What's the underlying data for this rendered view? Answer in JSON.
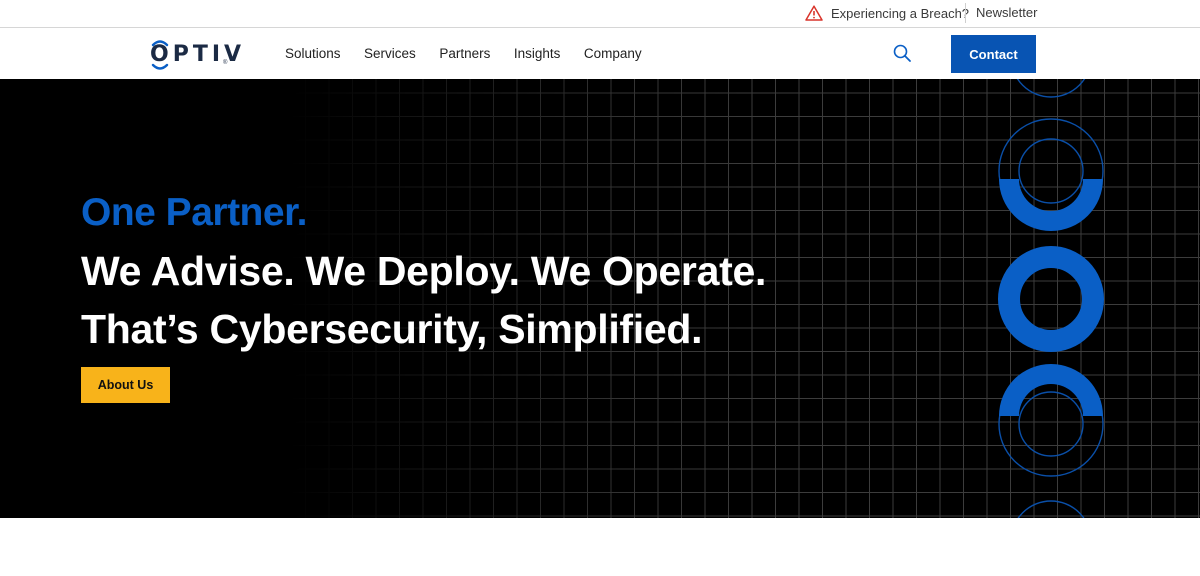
{
  "utility": {
    "breach_label": "Experiencing a Breach?",
    "newsletter_label": "Newsletter"
  },
  "nav": {
    "logo_text": "OPTIV",
    "logo_mark": "®",
    "links": [
      "Solutions",
      "Services",
      "Partners",
      "Insights",
      "Company"
    ],
    "contact_label": "Contact"
  },
  "hero": {
    "eyebrow": "One Partner.",
    "line1": "We Advise. We Deploy. We Operate.",
    "line2": "That’s Cybersecurity, Simplified.",
    "cta_label": "About Us"
  },
  "colors": {
    "brand_blue": "#0854b3",
    "hero_blue": "#0a5fc6",
    "cta_yellow": "#f8b31a",
    "warning_red": "#d9342b",
    "hero_background": "#000000"
  },
  "icons": {
    "breach": "warning-triangle-icon",
    "search": "search-icon"
  }
}
